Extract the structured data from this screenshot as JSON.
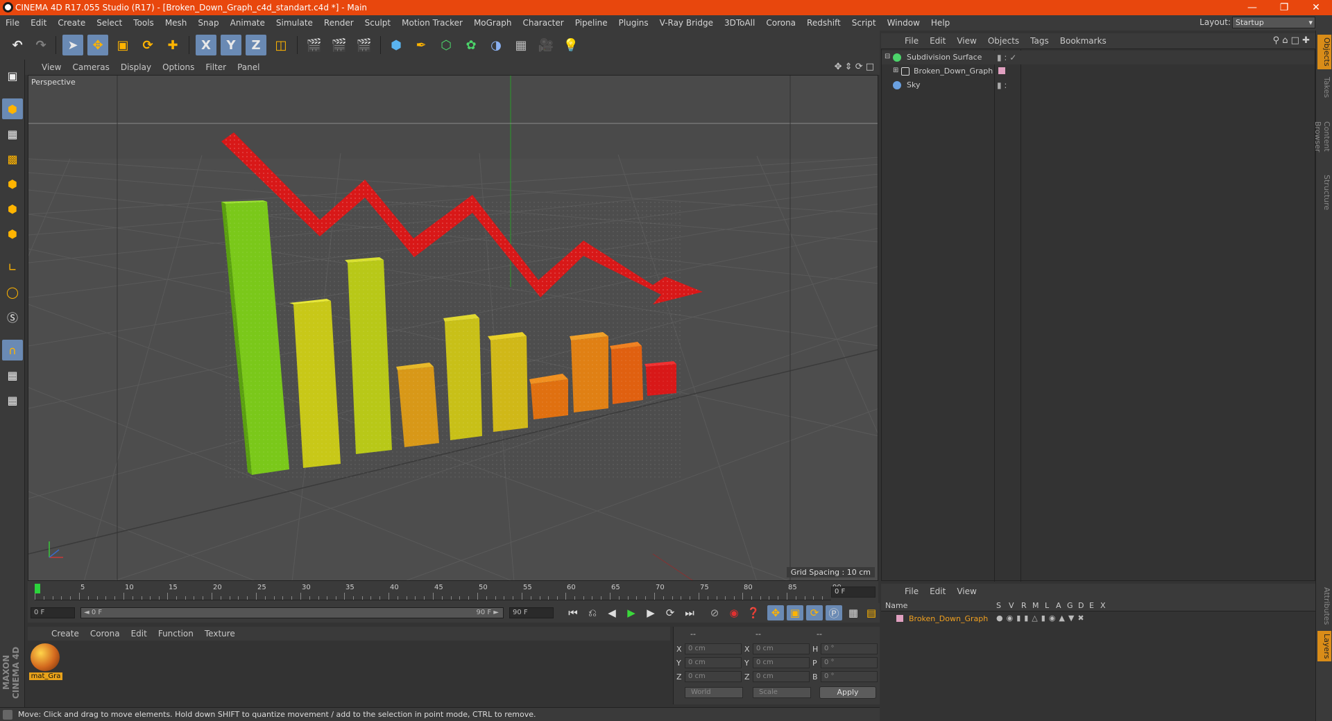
{
  "window": {
    "title": "CINEMA 4D R17.055 Studio (R17) - [Broken_Down_Graph_c4d_standart.c4d *] - Main",
    "min": "—",
    "max": "❐",
    "close": "✕"
  },
  "menu": [
    "File",
    "Edit",
    "Create",
    "Select",
    "Tools",
    "Mesh",
    "Snap",
    "Animate",
    "Simulate",
    "Render",
    "Sculpt",
    "Motion Tracker",
    "MoGraph",
    "Character",
    "Pipeline",
    "Plugins",
    "V-Ray Bridge",
    "3DToAll",
    "Corona",
    "Redshift",
    "Script",
    "Window",
    "Help"
  ],
  "layout": {
    "label": "Layout:",
    "value": "Startup"
  },
  "toolbar": {
    "x": "X",
    "y": "Y",
    "z": "Z"
  },
  "viewport": {
    "menu": [
      "View",
      "Cameras",
      "Display",
      "Options",
      "Filter",
      "Panel"
    ],
    "label": "Perspective",
    "grid_spacing": "Grid Spacing : 10 cm"
  },
  "timeline": {
    "ticks": [
      "0",
      "5",
      "10",
      "15",
      "20",
      "25",
      "30",
      "35",
      "40",
      "45",
      "50",
      "55",
      "60",
      "65",
      "70",
      "75",
      "80",
      "85",
      "90"
    ],
    "current": "0 F",
    "start": "0 F",
    "range_left": "◄ 0 F",
    "range_right": "90 F ►",
    "end": "90 F"
  },
  "materials": {
    "menu": [
      "Create",
      "Corona",
      "Edit",
      "Function",
      "Texture"
    ],
    "items": [
      {
        "label": "mat_Gra"
      }
    ]
  },
  "coords": {
    "header": [
      "--",
      "--",
      "--"
    ],
    "rows": [
      {
        "a": "X",
        "av": "0 cm",
        "b": "X",
        "bv": "0 cm",
        "c": "H",
        "cv": "0 °"
      },
      {
        "a": "Y",
        "av": "0 cm",
        "b": "Y",
        "bv": "0 cm",
        "c": "P",
        "cv": "0 °"
      },
      {
        "a": "Z",
        "av": "0 cm",
        "b": "Z",
        "bv": "0 cm",
        "c": "B",
        "cv": "0 °"
      }
    ],
    "mode": "World",
    "size_mode": "Scale",
    "apply": "Apply"
  },
  "objects": {
    "menu": [
      "File",
      "Edit",
      "View",
      "Objects",
      "Tags",
      "Bookmarks"
    ],
    "items": [
      {
        "name": "Subdivision Surface",
        "color": "#4cd46a"
      },
      {
        "name": "Broken_Down_Graph",
        "color": "#d8d8d8"
      },
      {
        "name": "Sky",
        "color": "#6aa0e0"
      }
    ]
  },
  "layers": {
    "menu": [
      "File",
      "Edit",
      "View"
    ],
    "columns": [
      "Name",
      "S",
      "V",
      "R",
      "M",
      "L",
      "A",
      "G",
      "D",
      "E",
      "X"
    ],
    "items": [
      {
        "name": "Broken_Down_Graph"
      }
    ]
  },
  "right_tabs": [
    "Objects",
    "Takes",
    "Content Browser",
    "Structure",
    "Attributes",
    "Layers"
  ],
  "status": "Move: Click and drag to move elements. Hold down SHIFT to quantize movement / add to the selection in point mode, CTRL to remove.",
  "brand": "MAXON CINEMA 4D",
  "colors": {
    "accent": "#e8470d",
    "selection": "#6a8ab4",
    "arrow": "#d81818"
  }
}
